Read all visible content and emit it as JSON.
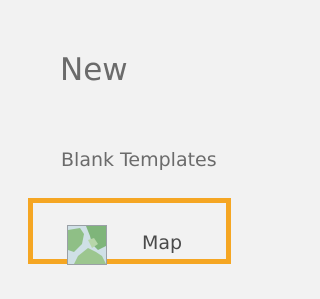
{
  "header": {
    "title": "New"
  },
  "section": {
    "heading": "Blank Templates"
  },
  "templates": [
    {
      "label": "Map",
      "icon": "map-thumbnail-icon",
      "selected": true,
      "highlight_color": "#f5a623"
    }
  ]
}
